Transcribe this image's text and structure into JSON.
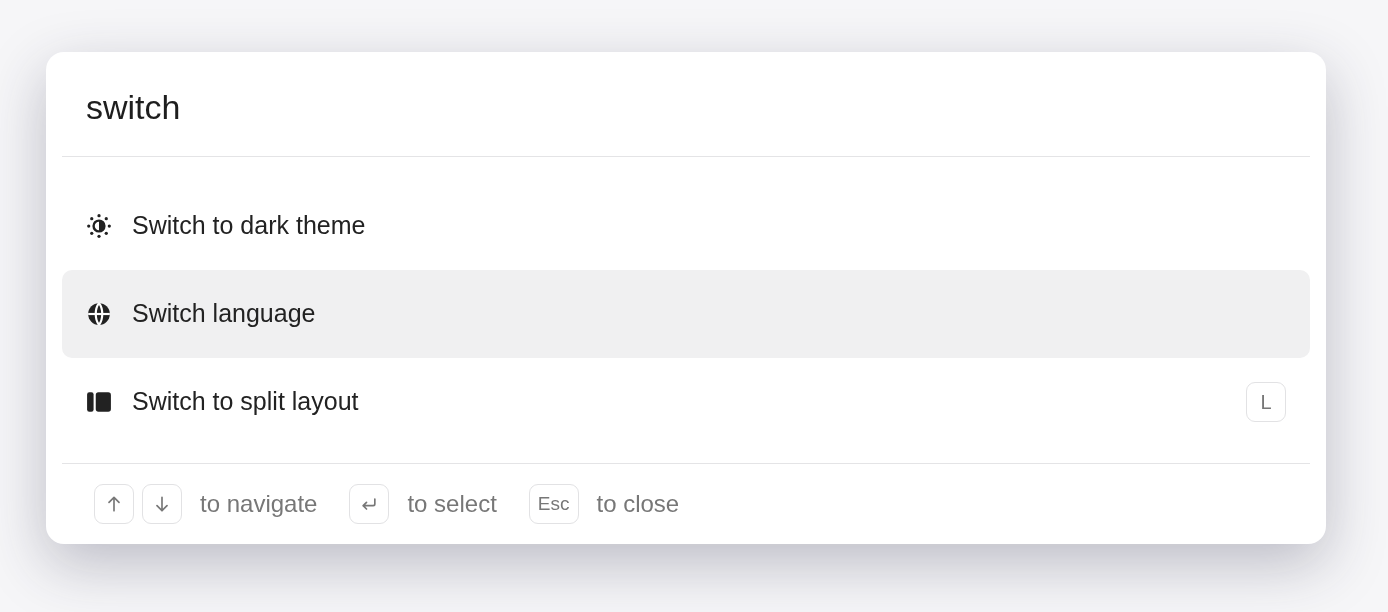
{
  "search": {
    "value": "switch"
  },
  "items": [
    {
      "kind": "theme",
      "label": "Switch to dark theme",
      "selected": false
    },
    {
      "kind": "language",
      "label": "Switch language",
      "selected": true
    },
    {
      "kind": "layout",
      "label": "Switch to split layout",
      "selected": false,
      "shortcut": "L"
    }
  ],
  "footer": [
    {
      "keys": [
        {
          "kind": "up"
        },
        {
          "kind": "down"
        }
      ],
      "label": "to navigate"
    },
    {
      "keys": [
        {
          "kind": "enter"
        }
      ],
      "label": "to select"
    },
    {
      "keys": [
        {
          "kind": "text",
          "text": "Esc"
        }
      ],
      "label": "to close"
    }
  ]
}
